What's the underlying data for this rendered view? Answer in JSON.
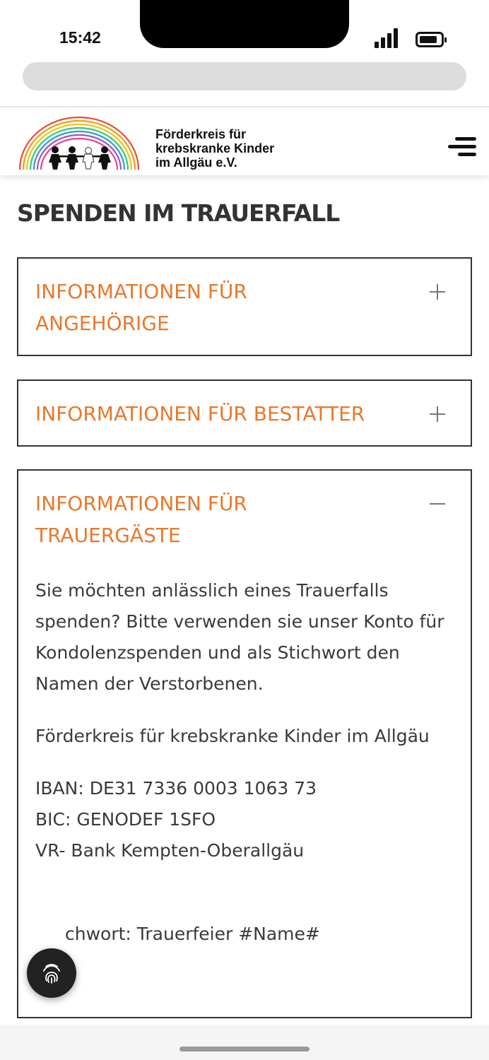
{
  "status_bar": {
    "time": "15:42"
  },
  "header": {
    "logo_lines": [
      "Förderkreis für",
      "krebskranke Kinder",
      "im Allgäu e.V."
    ]
  },
  "page": {
    "title": "SPENDEN IM TRAUERFALL"
  },
  "accordion": [
    {
      "title_lines": [
        "INFORMATIONEN FÜR",
        "ANGEHÖRIGE"
      ],
      "state": "collapsed",
      "icon": "plus-icon"
    },
    {
      "title_lines": [
        "INFORMATIONEN FÜR BESTATTER"
      ],
      "state": "collapsed",
      "icon": "plus-icon"
    },
    {
      "title_lines": [
        "INFORMATIONEN FÜR",
        "TRAUERGÄSTE"
      ],
      "state": "expanded",
      "icon": "minus-icon",
      "body": {
        "intro": "Sie möchten anlässlich eines Trauerfalls spenden? Bitte verwenden sie unser Konto für Kondolenzspenden und als Stichwort den Namen der Verstorbenen.",
        "org": "Förderkreis für krebskranke Kinder im Allgäu",
        "iban": "IBAN: DE31 7336 0003 1063 73",
        "bic": "BIC: GENODEF 1SFO",
        "bank": "VR- Bank Kempten-Oberallgäu",
        "stichwort": "chwort: Trauerfeier #Name#"
      }
    }
  ],
  "colors": {
    "accent": "#e8782a",
    "text": "#333333",
    "border": "#333333"
  }
}
